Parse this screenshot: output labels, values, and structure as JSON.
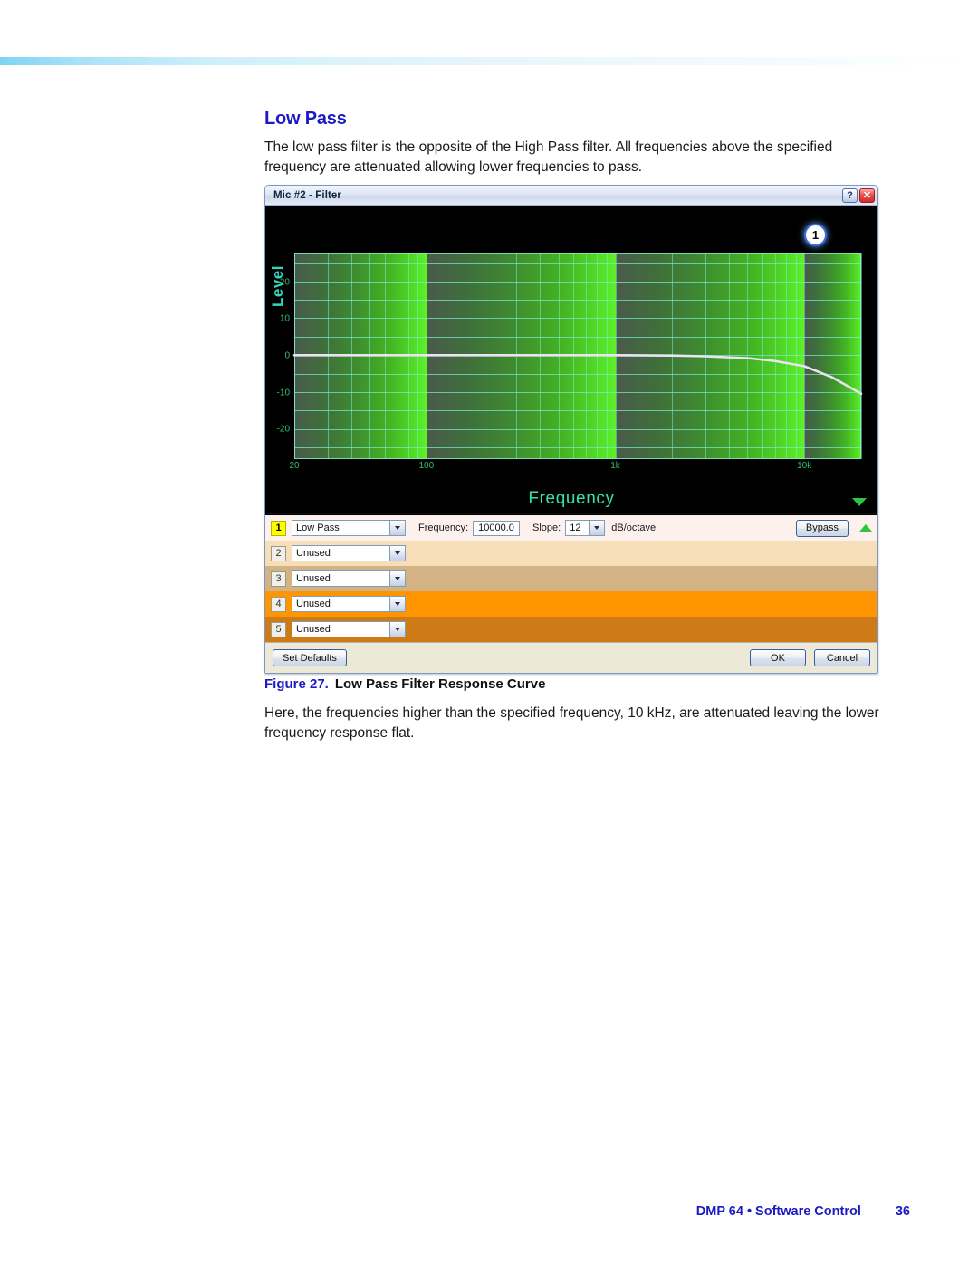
{
  "document": {
    "section_title": "Low Pass",
    "intro": "The low pass filter is the opposite of the High Pass filter. All frequencies above the specified frequency are attenuated allowing lower frequencies to pass.",
    "figure_number": "Figure 27.",
    "figure_caption": "Low Pass Filter Response Curve",
    "after_text": "Here, the frequencies higher than the specified frequency, 10 kHz, are attenuated leaving the lower frequency response flat.",
    "footer_text": "DMP 64 • Software Control",
    "page_number": "36"
  },
  "dialog": {
    "title": "Mic #2 - Filter",
    "help_label": "?",
    "close_label": "✕",
    "graph": {
      "badge_label": "1",
      "y_axis_label": "Level",
      "x_axis_label": "Frequency"
    },
    "controls": {
      "frequency_label": "Frequency:",
      "frequency_value": "10000.0",
      "slope_label": "Slope:",
      "slope_value": "12",
      "slope_unit": "dB/octave",
      "bypass_label": "Bypass"
    },
    "rows": [
      {
        "num": "1",
        "filter": "Low Pass",
        "active": true
      },
      {
        "num": "2",
        "filter": "Unused",
        "active": false
      },
      {
        "num": "3",
        "filter": "Unused",
        "active": false
      },
      {
        "num": "4",
        "filter": "Unused",
        "active": false
      },
      {
        "num": "5",
        "filter": "Unused",
        "active": false
      }
    ],
    "buttons": {
      "set_defaults": "Set Defaults",
      "ok": "OK",
      "cancel": "Cancel"
    }
  },
  "chart_data": {
    "type": "line",
    "title": "Low Pass Filter Response Curve",
    "xlabel": "Frequency",
    "ylabel": "Level",
    "x_ticks": [
      "20",
      "100",
      "1k",
      "10k"
    ],
    "x_tick_values": [
      20,
      100,
      1000,
      10000
    ],
    "y_ticks": [
      "20",
      "10",
      "0",
      "-10",
      "-20"
    ],
    "y_tick_values": [
      20,
      10,
      0,
      -10,
      -20
    ],
    "ylim": [
      -28,
      28
    ],
    "xlim": [
      20,
      20000
    ],
    "x_log_scale": true,
    "grid": true,
    "legend": "none",
    "series": [
      {
        "name": "Low Pass 10 kHz, 12 dB/octave",
        "color": "#e8e4f5",
        "x": [
          20,
          50,
          100,
          200,
          500,
          1000,
          2000,
          3000,
          5000,
          7000,
          10000,
          14000,
          20000
        ],
        "y": [
          0,
          0,
          0,
          0,
          0,
          0,
          -0.1,
          -0.3,
          -0.8,
          -1.6,
          -3.0,
          -6.0,
          -10.5
        ]
      }
    ],
    "annotations": [
      {
        "label": "1",
        "x": 14000,
        "y": 26
      }
    ],
    "background_bands": [
      {
        "from": 20,
        "to": 100,
        "style": "dark-to-bright-green-gradient"
      },
      {
        "from": 100,
        "to": 1000,
        "style": "dark-to-bright-green-gradient"
      },
      {
        "from": 1000,
        "to": 10000,
        "style": "dark-to-bright-green-gradient"
      },
      {
        "from": 10000,
        "to": 20000,
        "style": "dark-to-bright-green-gradient"
      }
    ]
  }
}
